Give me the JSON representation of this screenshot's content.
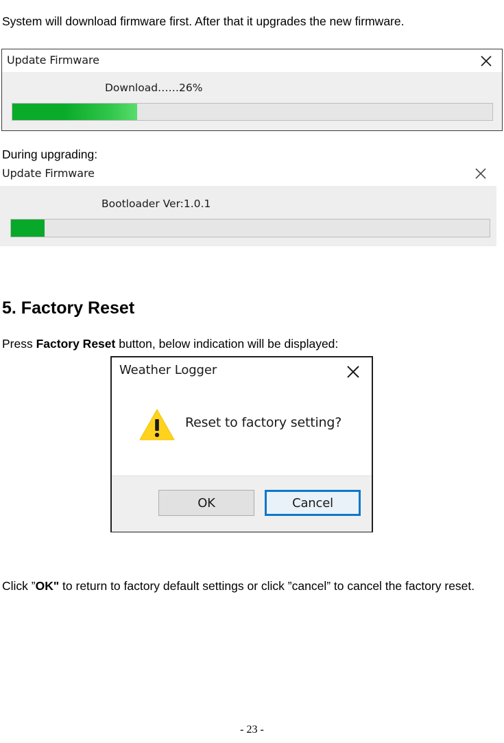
{
  "document": {
    "intro_paragraph": "System will download firmware first. After that it upgrades the new firmware.",
    "during_label": "During upgrading:",
    "section_heading": "5. Factory Reset",
    "press_paragraph_before": "Press ",
    "press_paragraph_bold": "Factory Reset",
    "press_paragraph_after": " button, below indication will be displayed:",
    "click_paragraph_before": "Click ”",
    "click_paragraph_bold": "OK\"",
    "click_paragraph_after": " to return to factory default settings or click ”cancel” to cancel the factory reset.",
    "page_number": "- 23 -"
  },
  "firmware_dialog_download": {
    "title": "Update Firmware",
    "close_icon": "close-icon",
    "status_text": "Download……26%",
    "progress_percent": 26,
    "fill_color": "#0bab2a",
    "trough_color": "#e6e6e6"
  },
  "firmware_dialog_bootloader": {
    "title": "Update Firmware",
    "close_icon": "close-icon",
    "status_text": "Bootloader Ver:1.0.1",
    "progress_percent": 7,
    "fill_color": "#08a82a",
    "trough_color": "#e6e6e6"
  },
  "weather_logger_dialog": {
    "title": "Weather Logger",
    "close_icon": "close-icon",
    "warning_icon": "warning-triangle-icon",
    "warning_color": "#FFD21E",
    "message": "Reset to factory setting?",
    "ok_label": "OK",
    "cancel_label": "Cancel",
    "focus_color": "#0d77c9"
  }
}
